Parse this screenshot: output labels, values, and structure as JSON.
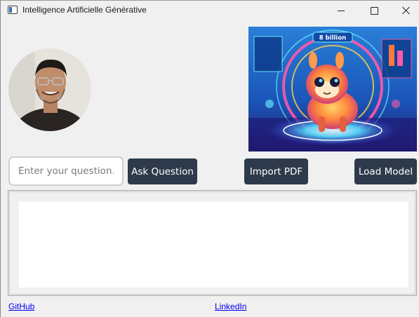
{
  "window": {
    "title": "Intelligence Artificielle Générative",
    "icons": {
      "app": "app-window-icon",
      "minimize": "minimize-icon",
      "maximize": "maximize-icon",
      "close": "close-icon"
    }
  },
  "header": {
    "avatar": "profile-photo",
    "banner": {
      "image": "llama-mascot-futuristic-banner",
      "caption": "8 billion"
    }
  },
  "controls": {
    "question_placeholder": "Enter your question...",
    "question_value": "",
    "ask_label": "Ask Question",
    "import_label": "Import PDF",
    "load_label": "Load Model"
  },
  "output": {
    "text": ""
  },
  "footer": {
    "github_label": "GitHub",
    "linkedin_label": "LinkedIn"
  },
  "colors": {
    "background": "#f0f0f0",
    "button_bg": "#2e3a4b",
    "button_text": "#ffffff",
    "link": "#0000ee"
  }
}
